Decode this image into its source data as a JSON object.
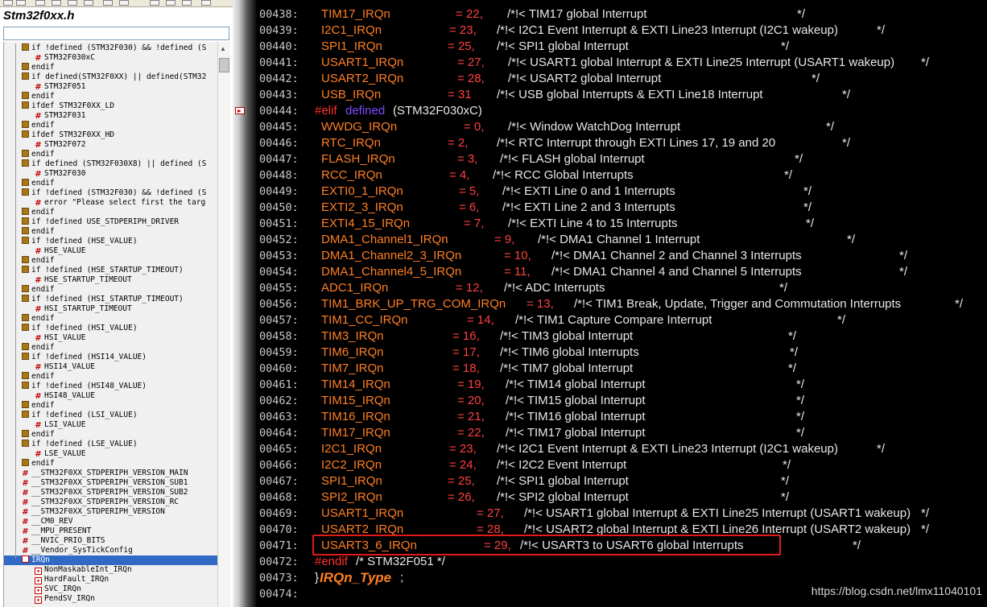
{
  "left_panel": {
    "title": "Stm32f0xx.h",
    "filter_value": "",
    "tree": [
      {
        "label": "if !defined (STM32F030) && !defined (S",
        "icon": "preproc",
        "indent": 0
      },
      {
        "label": "STM32F030xC",
        "icon": "define",
        "indent": 1
      },
      {
        "label": "endif",
        "icon": "preproc",
        "indent": 0
      },
      {
        "label": "if defined(STM32F0XX) || defined(STM32",
        "icon": "preproc",
        "indent": 0
      },
      {
        "label": "STM32F051",
        "icon": "define",
        "indent": 1
      },
      {
        "label": "endif",
        "icon": "preproc",
        "indent": 0
      },
      {
        "label": "ifdef STM32F0XX_LD",
        "icon": "preproc",
        "indent": 0
      },
      {
        "label": "STM32F031",
        "icon": "define",
        "indent": 1
      },
      {
        "label": "endif",
        "icon": "preproc",
        "indent": 0
      },
      {
        "label": "ifdef STM32F0XX_HD",
        "icon": "preproc",
        "indent": 0
      },
      {
        "label": "STM32F072",
        "icon": "define",
        "indent": 1
      },
      {
        "label": "endif",
        "icon": "preproc",
        "indent": 0
      },
      {
        "label": "if defined (STM32F030X8) || defined (S",
        "icon": "preproc",
        "indent": 0
      },
      {
        "label": "STM32F030",
        "icon": "define",
        "indent": 1
      },
      {
        "label": "endif",
        "icon": "preproc",
        "indent": 0
      },
      {
        "label": "if !defined (STM32F030) && !defined (S",
        "icon": "preproc",
        "indent": 0
      },
      {
        "label": "error \"Please select first the targ",
        "icon": "define",
        "indent": 1
      },
      {
        "label": "endif",
        "icon": "preproc",
        "indent": 0
      },
      {
        "label": "if !defined USE_STDPERIPH_DRIVER",
        "icon": "preproc",
        "indent": 0
      },
      {
        "label": "endif",
        "icon": "preproc",
        "indent": 0
      },
      {
        "label": "if !defined  (HSE_VALUE)",
        "icon": "preproc",
        "indent": 0
      },
      {
        "label": "HSE_VALUE",
        "icon": "define",
        "indent": 1
      },
      {
        "label": "endif",
        "icon": "preproc",
        "indent": 0
      },
      {
        "label": "if !defined  (HSE_STARTUP_TIMEOUT)",
        "icon": "preproc",
        "indent": 0
      },
      {
        "label": "HSE_STARTUP_TIMEOUT",
        "icon": "define",
        "indent": 1
      },
      {
        "label": "endif",
        "icon": "preproc",
        "indent": 0
      },
      {
        "label": "if !defined  (HSI_STARTUP_TIMEOUT)",
        "icon": "preproc",
        "indent": 0
      },
      {
        "label": "HSI_STARTUP_TIMEOUT",
        "icon": "define",
        "indent": 1
      },
      {
        "label": "endif",
        "icon": "preproc",
        "indent": 0
      },
      {
        "label": "if !defined  (HSI_VALUE)",
        "icon": "preproc",
        "indent": 0
      },
      {
        "label": "HSI_VALUE",
        "icon": "define",
        "indent": 1
      },
      {
        "label": "endif",
        "icon": "preproc",
        "indent": 0
      },
      {
        "label": "if !defined  (HSI14_VALUE)",
        "icon": "preproc",
        "indent": 0
      },
      {
        "label": "HSI14_VALUE",
        "icon": "define",
        "indent": 1
      },
      {
        "label": "endif",
        "icon": "preproc",
        "indent": 0
      },
      {
        "label": "if !defined  (HSI48_VALUE)",
        "icon": "preproc",
        "indent": 0
      },
      {
        "label": "HSI48_VALUE",
        "icon": "define",
        "indent": 1
      },
      {
        "label": "endif",
        "icon": "preproc",
        "indent": 0
      },
      {
        "label": "if !defined  (LSI_VALUE)",
        "icon": "preproc",
        "indent": 0
      },
      {
        "label": "LSI_VALUE",
        "icon": "define",
        "indent": 1
      },
      {
        "label": "endif",
        "icon": "preproc",
        "indent": 0
      },
      {
        "label": "if !defined  (LSE_VALUE)",
        "icon": "preproc",
        "indent": 0
      },
      {
        "label": "LSE_VALUE",
        "icon": "define",
        "indent": 1
      },
      {
        "label": "endif",
        "icon": "preproc",
        "indent": 0
      },
      {
        "label": "__STM32F0XX_STDPERIPH_VERSION_MAIN",
        "icon": "define",
        "indent": 0
      },
      {
        "label": "__STM32F0XX_STDPERIPH_VERSION_SUB1",
        "icon": "define",
        "indent": 0
      },
      {
        "label": "__STM32F0XX_STDPERIPH_VERSION_SUB2",
        "icon": "define",
        "indent": 0
      },
      {
        "label": "__STM32F0XX_STDPERIPH_VERSION_RC",
        "icon": "define",
        "indent": 0
      },
      {
        "label": "__STM32F0XX_STDPERIPH_VERSION",
        "icon": "define",
        "indent": 0
      },
      {
        "label": "__CM0_REV",
        "icon": "define",
        "indent": 0
      },
      {
        "label": "__MPU_PRESENT",
        "icon": "define",
        "indent": 0
      },
      {
        "label": "__NVIC_PRIO_BITS",
        "icon": "define",
        "indent": 0
      },
      {
        "label": "__Vendor_SysTickConfig",
        "icon": "define",
        "indent": 0
      },
      {
        "label": "IRQn",
        "icon": "enum",
        "indent": 0,
        "selected": true
      },
      {
        "label": "NonMaskableInt_IRQn",
        "icon": "member",
        "indent": 1
      },
      {
        "label": "HardFault_IRQn",
        "icon": "member",
        "indent": 1
      },
      {
        "label": "SVC_IRQn",
        "icon": "member",
        "indent": 1
      },
      {
        "label": "PendSV_IRQn",
        "icon": "member",
        "indent": 1
      }
    ]
  },
  "editor": {
    "lines": [
      {
        "num": "00438:",
        "kind": "enum",
        "name": "TIM17_IRQn",
        "value": "= 22,",
        "comment": "/*!< TIM17 global Interrupt",
        "end": "*/",
        "vx": [
          566,
          630,
          990
        ]
      },
      {
        "num": "00439:",
        "kind": "enum",
        "name": "I2C1_IRQn",
        "value": "= 23,",
        "comment": "/*!< I2C1 Event Interrupt & EXTI Line23 Interrupt (I2C1 wakeup)",
        "end": "*/",
        "vx": [
          558,
          617,
          1089
        ]
      },
      {
        "num": "00440:",
        "kind": "enum",
        "name": "SPI1_IRQn",
        "value": "= 25,",
        "comment": "/*!< SPI1 global Interrupt",
        "end": "*/",
        "vx": [
          556,
          617,
          970
        ]
      },
      {
        "num": "00441:",
        "kind": "enum",
        "name": "USART1_IRQn",
        "value": "= 27,",
        "comment": "/*!< USART1 global Interrupt & EXTI Line25 Interrupt (USART1 wakeup)",
        "end": "*/",
        "vx": [
          568,
          631,
          1144
        ]
      },
      {
        "num": "00442:",
        "kind": "enum",
        "name": "USART2_IRQn",
        "value": "= 28,",
        "comment": "/*!< USART2 global Interrupt",
        "end": "*/",
        "vx": [
          568,
          631,
          1008
        ]
      },
      {
        "num": "00443:",
        "kind": "enum",
        "name": "USB_IRQn",
        "value": "= 31",
        "comment": "/*!< USB global Interrupts & EXTI Line18 Interrupt",
        "end": "*/",
        "vx": [
          556,
          617,
          1046
        ]
      },
      {
        "num": "00444:",
        "kind": "elif",
        "pre": "#elif",
        "kw": "defined",
        "rest": "(STM32F030xC)"
      },
      {
        "num": "00445:",
        "kind": "enum",
        "name": "WWDG_IRQn",
        "value": "= 0,",
        "comment": "/*!< Window WatchDog Interrupt",
        "end": "*/",
        "vx": [
          576,
          631,
          1026
        ]
      },
      {
        "num": "00446:",
        "kind": "enum",
        "name": "RTC_IRQn",
        "value": "= 2,",
        "comment": "/*!< RTC Interrupt through EXTI Lines 17, 19 and 20",
        "end": "*/",
        "vx": [
          556,
          617,
          1046
        ]
      },
      {
        "num": "00447:",
        "kind": "enum",
        "name": "FLASH_IRQn",
        "value": "= 3,",
        "comment": "/*!< FLASH global Interrupt",
        "end": "*/",
        "vx": [
          568,
          621,
          987
        ]
      },
      {
        "num": "00448:",
        "kind": "enum",
        "name": "RCC_IRQn",
        "value": "= 4,",
        "comment": "/*!< RCC Global Interrupts",
        "end": "*/",
        "vx": [
          558,
          612,
          974
        ]
      },
      {
        "num": "00449:",
        "kind": "enum",
        "name": "EXTI0_1_IRQn",
        "value": "= 5,",
        "comment": "/*!< EXTI Line 0 and 1 Interrupts",
        "end": "*/",
        "vx": [
          570,
          624,
          998
        ]
      },
      {
        "num": "00450:",
        "kind": "enum",
        "name": "EXTI2_3_IRQn",
        "value": "= 6,",
        "comment": "/*!< EXTI Line 2 and 3 Interrupts",
        "end": "*/",
        "vx": [
          570,
          624,
          998
        ]
      },
      {
        "num": "00451:",
        "kind": "enum",
        "name": "EXTI4_15_IRQn",
        "value": "= 7,",
        "comment": "/*!< EXTI Line 4 to 15 Interrupts",
        "end": "*/",
        "vx": [
          576,
          631,
          1001
        ]
      },
      {
        "num": "00452:",
        "kind": "enum",
        "name": "DMA1_Channel1_IRQn",
        "value": "= 9,",
        "comment": "/*!< DMA1 Channel 1 Interrupt",
        "end": "*/",
        "vx": [
          614,
          668,
          1052
        ]
      },
      {
        "num": "00453:",
        "kind": "enum",
        "name": "DMA1_Channel2_3_IRQn",
        "value": "= 10,",
        "comment": "/*!< DMA1 Channel 2 and Channel 3 Interrupts",
        "end": "*/",
        "vx": [
          626,
          685,
          1117
        ]
      },
      {
        "num": "00454:",
        "kind": "enum",
        "name": "DMA1_Channel4_5_IRQn",
        "value": "= 11,",
        "comment": "/*!< DMA1 Channel 4 and Channel 5 Interrupts",
        "end": "*/",
        "vx": [
          626,
          685,
          1117
        ]
      },
      {
        "num": "00455:",
        "kind": "enum",
        "name": "ADC1_IRQn",
        "value": "= 12,",
        "comment": "/*!< ADC Interrupts",
        "end": "*/",
        "vx": [
          566,
          626,
          968
        ]
      },
      {
        "num": "00456:",
        "kind": "enum",
        "name": "TIM1_BRK_UP_TRG_COM_IRQn",
        "value": "= 13,",
        "comment": "/*!< TIM1 Break, Update, Trigger and Commutation Interrupts",
        "end": "*/",
        "vx": [
          654,
          713,
          1186
        ]
      },
      {
        "num": "00457:",
        "kind": "enum",
        "name": "TIM1_CC_IRQn",
        "value": "= 14,",
        "comment": "/*!< TIM1 Capture Compare Interrupt",
        "end": "*/",
        "vx": [
          580,
          640,
          1040
        ]
      },
      {
        "num": "00458:",
        "kind": "enum",
        "name": "TIM3_IRQn",
        "value": "= 16,",
        "comment": "/*!< TIM3 global Interrupt",
        "end": "*/",
        "vx": [
          562,
          621,
          979
        ]
      },
      {
        "num": "00459:",
        "kind": "enum",
        "name": "TIM6_IRQn",
        "value": "= 17,",
        "comment": "/*!< TIM6 global Interrupts",
        "end": "*/",
        "vx": [
          562,
          621,
          981
        ]
      },
      {
        "num": "00460:",
        "kind": "enum",
        "name": "TIM7_IRQn",
        "value": "= 18,",
        "comment": "/*!< TIM7 global Interrupt",
        "end": "*/",
        "vx": [
          562,
          621,
          979
        ]
      },
      {
        "num": "00461:",
        "kind": "enum",
        "name": "TIM14_IRQn",
        "value": "= 19,",
        "comment": "/*!< TIM14 global Interrupt",
        "end": "*/",
        "vx": [
          568,
          628,
          989
        ]
      },
      {
        "num": "00462:",
        "kind": "enum",
        "name": "TIM15_IRQn",
        "value": "= 20,",
        "comment": "/*!< TIM15 global Interrupt",
        "end": "*/",
        "vx": [
          568,
          628,
          989
        ]
      },
      {
        "num": "00463:",
        "kind": "enum",
        "name": "TIM16_IRQn",
        "value": "= 21,",
        "comment": "/*!< TIM16 global Interrupt",
        "end": "*/",
        "vx": [
          568,
          628,
          989
        ]
      },
      {
        "num": "00464:",
        "kind": "enum",
        "name": "TIM17_IRQn",
        "value": "= 22,",
        "comment": "/*!< TIM17 global Interrupt",
        "end": "*/",
        "vx": [
          568,
          628,
          989
        ]
      },
      {
        "num": "00465:",
        "kind": "enum",
        "name": "I2C1_IRQn",
        "value": "= 23,",
        "comment": "/*!< I2C1 Event Interrupt & EXTI Line23 Interrupt (I2C1 wakeup)",
        "end": "*/",
        "vx": [
          558,
          617,
          1089
        ]
      },
      {
        "num": "00466:",
        "kind": "enum",
        "name": "I2C2_IRQn",
        "value": "= 24,",
        "comment": "/*!< I2C2 Event Interrupt",
        "end": "*/",
        "vx": [
          558,
          617,
          972
        ]
      },
      {
        "num": "00467:",
        "kind": "enum",
        "name": "SPI1_IRQn",
        "value": "= 25,",
        "comment": "/*!< SPI1 global Interrupt",
        "end": "*/",
        "vx": [
          556,
          617,
          970
        ]
      },
      {
        "num": "00468:",
        "kind": "enum",
        "name": "SPI2_IRQn",
        "value": "= 26,",
        "comment": "/*!< SPI2 global Interrupt",
        "end": "*/",
        "vx": [
          556,
          617,
          970
        ]
      },
      {
        "num": "00469:",
        "kind": "enum",
        "name": "USART1_IRQn",
        "value": "= 27,",
        "comment": "/*!< USART1 global Interrupt & EXTI Line25 Interrupt (USART1 wakeup)",
        "end": "*/",
        "vx": [
          592,
          651,
          1144
        ]
      },
      {
        "num": "00470:",
        "kind": "enum",
        "name": "USART2_IRQn",
        "value": "= 28,",
        "comment": "/*!< USART2 global Interrupt & EXTI Line26 Interrupt (USART2 wakeup)",
        "end": "*/",
        "vx": [
          592,
          651,
          1144
        ]
      },
      {
        "num": "00471:",
        "kind": "enum",
        "name": "USART3_6_IRQn",
        "value": "= 29,",
        "comment": "/*!< USART3 to USART6 global Interrupts",
        "end": "*/",
        "vx": [
          601,
          646,
          1059
        ]
      },
      {
        "num": "00472:",
        "kind": "endif",
        "pre": "#endif",
        "rest": "/* STM32F051 */"
      },
      {
        "num": "00473:",
        "kind": "close",
        "brace": "}",
        "type": "IRQn_Type",
        "semi": ";"
      },
      {
        "num": "00474:",
        "kind": "blank"
      }
    ]
  },
  "watermark": "https://blog.csdn.net/lmx11040101"
}
